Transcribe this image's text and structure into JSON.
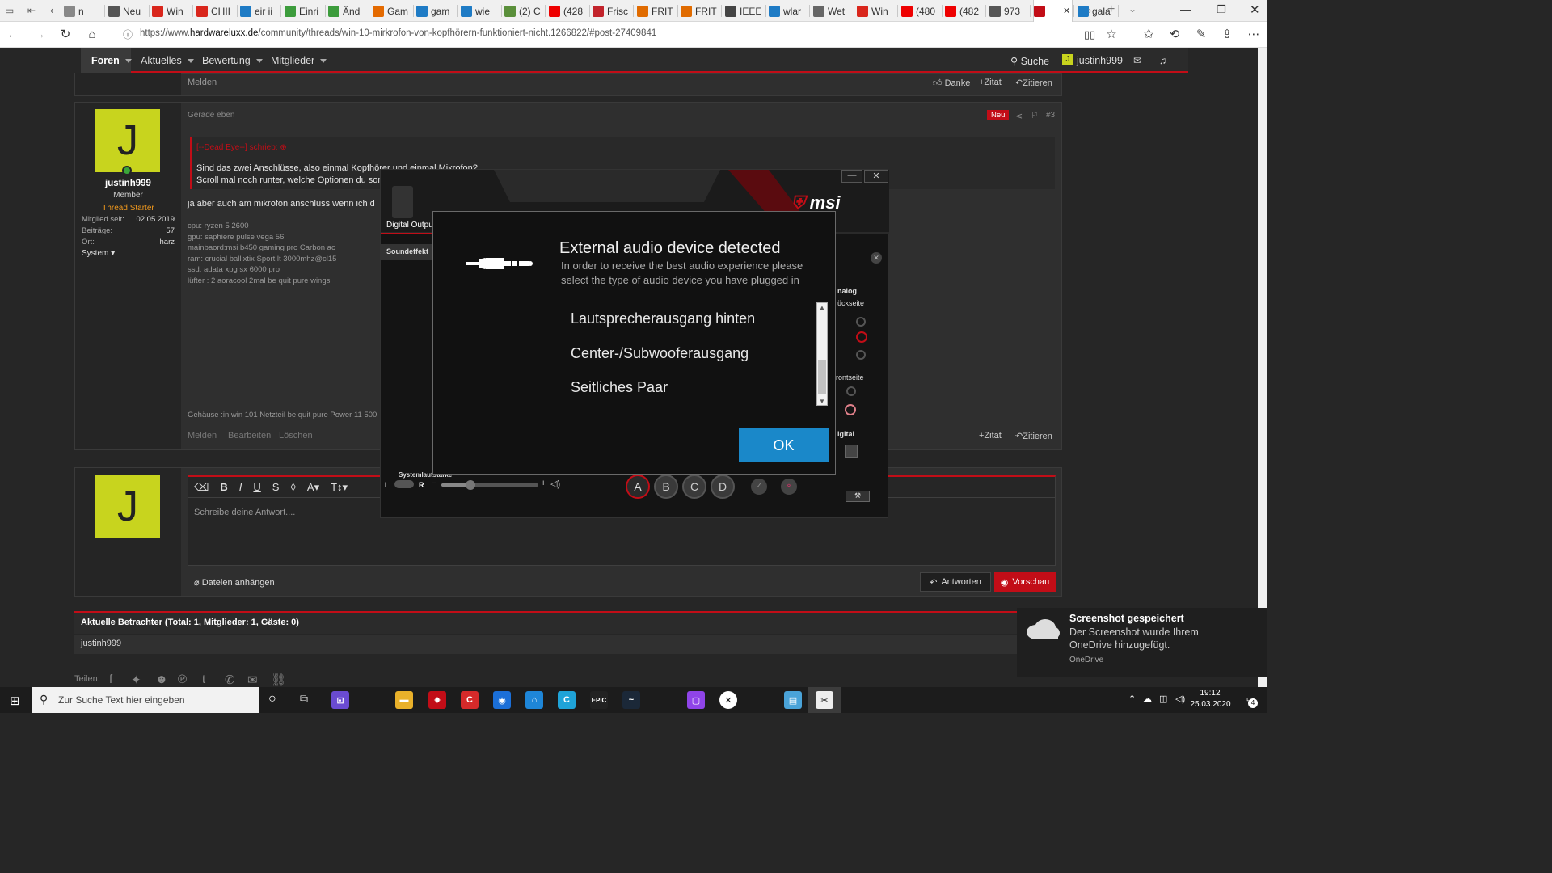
{
  "browser": {
    "tabs": [
      {
        "label": "n",
        "color": "#888"
      },
      {
        "label": "Neu",
        "color": "#555"
      },
      {
        "label": "Win",
        "color": "#d9261c"
      },
      {
        "label": "CHII",
        "color": "#d9261c"
      },
      {
        "label": "eir ii",
        "color": "#1e7bc5"
      },
      {
        "label": "Einri",
        "color": "#3c9c3c"
      },
      {
        "label": "Änd",
        "color": "#3c9c3c"
      },
      {
        "label": "Gam",
        "color": "#e46a00"
      },
      {
        "label": "gam",
        "color": "#1e7bc5"
      },
      {
        "label": "wie",
        "color": "#1e7bc5"
      },
      {
        "label": "(2) C",
        "color": "#5a8f3a"
      },
      {
        "label": "(428",
        "color": "#e00"
      },
      {
        "label": "Frisc",
        "color": "#c2232b"
      },
      {
        "label": "FRIT",
        "color": "#e06b00"
      },
      {
        "label": "FRIT",
        "color": "#e06b00"
      },
      {
        "label": "IEEE",
        "color": "#444"
      },
      {
        "label": "wlar",
        "color": "#1e7bc5"
      },
      {
        "label": "Wet",
        "color": "#666"
      },
      {
        "label": "Win",
        "color": "#d9261c"
      },
      {
        "label": "(480",
        "color": "#e00"
      },
      {
        "label": "(482",
        "color": "#e00"
      },
      {
        "label": "973",
        "color": "#555"
      },
      {
        "label": "",
        "color": "#c20d17"
      },
      {
        "label": "gala",
        "color": "#1e7bc5"
      }
    ],
    "url_prefix": "https://www.",
    "url_domain": "hardwareluxx.de",
    "url_rest": "/community/threads/win-10-mirkrofon-von-kopfhörern-funktioniert-nicht.1266822/#post-27409841"
  },
  "forum_nav": {
    "items": [
      "Foren",
      "Aktuelles",
      "Bewertung",
      "Mitglieder"
    ],
    "search": "Suche",
    "user": "justinh999",
    "avatar_letter": "J"
  },
  "prev_post": {
    "report": "Melden",
    "like": "Danke",
    "quote": "Zitat",
    "reply": "Zitieren"
  },
  "post": {
    "avatar_letter": "J",
    "username": "justinh999",
    "role": "Member",
    "badge": "Thread Starter",
    "stats": [
      {
        "label": "Mitglied seit:",
        "value": "02.05.2019"
      },
      {
        "label": "Beiträge:",
        "value": "57"
      },
      {
        "label": "Ort:",
        "value": "harz"
      }
    ],
    "system": "System",
    "time": "Gerade eben",
    "new_badge": "Neu",
    "post_number": "#3",
    "quote_author": "[--Dead Eye--] schrieb:",
    "quote_line1": "Sind das zwei Anschlüsse, also einmal Kopfhörer und einmal Mikrofon?",
    "quote_line2": "Scroll mal noch runter, welche Optionen du sons",
    "body": "ja aber auch am mikrofon anschluss wenn ich d",
    "signature": [
      "cpu: ryzen 5 2600",
      "gpu: saphiere pulse vega 56",
      "mainbaord:msi b450 gaming pro Carbon ac",
      "ram: crucial ballixtix Sport lt 3000mhz@cl15",
      "ssd: adata xpg sx 6000 pro",
      "lüfter : 2 aoracool 2mal be quit pure wings"
    ],
    "signature_last": "Gehäuse :in win 101 Netzteil be quit pure Power 11 500",
    "actions": [
      "Melden",
      "Bearbeiten",
      "Löschen"
    ],
    "quote_btn": "Zitat",
    "reply_btn": "Zitieren"
  },
  "reply_box": {
    "avatar_letter": "J",
    "placeholder": "Schreibe deine Antwort....",
    "attach": "Dateien anhängen",
    "submit": "Antworten",
    "preview": "Vorschau"
  },
  "viewers": {
    "title": "Aktuelle Betrachter (Total: 1, Mitglieder: 1, Gäste: 0)",
    "user": "justinh999",
    "share_label": "Teilen:"
  },
  "msi": {
    "brand": "msi",
    "digital_output": "Digital Output",
    "soundeffect": "Soundeffekt",
    "system_volume": "Systemlautstärke",
    "left": "L",
    "right": "R",
    "analog": "nalog",
    "rueckseite": "ückseite",
    "frontseite": "rontseite",
    "digital": "igital",
    "ports": [
      "A",
      "B",
      "C",
      "D"
    ],
    "volume_level": 0.3
  },
  "dialog": {
    "title": "External audio device detected",
    "subtitle_line1": "In order to receive the best audio experience please",
    "subtitle_line2": "select the type of audio device you have plugged in",
    "options": [
      "Lautsprecherausgang hinten",
      "Center-/Subwooferausgang",
      "Seitliches Paar"
    ],
    "ok": "OK"
  },
  "toast": {
    "title": "Screenshot gespeichert",
    "line1": "Der Screenshot wurde Ihrem",
    "line2": "OneDrive hinzugefügt.",
    "source": "OneDrive"
  },
  "taskbar": {
    "search_placeholder": "Zur Suche Text hier eingeben",
    "time": "19:12",
    "date": "25.03.2020",
    "notification_count": "4"
  }
}
